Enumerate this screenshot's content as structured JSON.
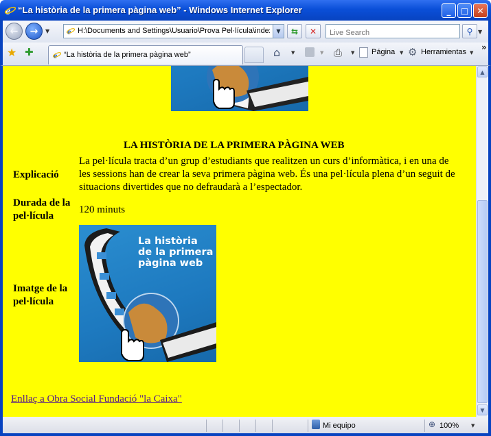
{
  "window": {
    "title": "“La història de la primera pàgina web” - Windows Internet Explorer",
    "controls": {
      "minimize": "_",
      "maximize": "□",
      "close": "✕"
    }
  },
  "addressbar": {
    "url": "H:\\Documents and Settings\\Usuario\\Prova Pel·lícula\\index.",
    "search_placeholder": "Live Search"
  },
  "tab": {
    "label": "“La història de la primera pàgina web”"
  },
  "commands": {
    "page": "Página",
    "tools": "Herramientas",
    "more": "»"
  },
  "page": {
    "heading": "LA HISTÒRIA DE LA PRIMERA PÀGINA WEB",
    "rows": [
      {
        "label": "Explicació",
        "text": "La pel·lícula tracta d’un grup d’estudiants que realitzen un curs d’informàtica, i en una de les sessions han de crear la seva primera pàgina web. És una pel·lícula plena d’un seguit de situacions divertides que no defraudarà a l’espectador."
      },
      {
        "label": "Durada de la pel·lícula",
        "text": "120 minuts"
      },
      {
        "label": "Imatge de la pel·lícula"
      }
    ],
    "poster_text": "La història de la primera pàgina web",
    "link": "Enllaç a Obra Social Fundació \"la Caixa\""
  },
  "statusbar": {
    "zone": "Mi equipo",
    "zoom": "100%"
  },
  "colors": {
    "page_background": "#ffff00",
    "link": "#551a8b",
    "chrome_blue": "#0843c0"
  }
}
